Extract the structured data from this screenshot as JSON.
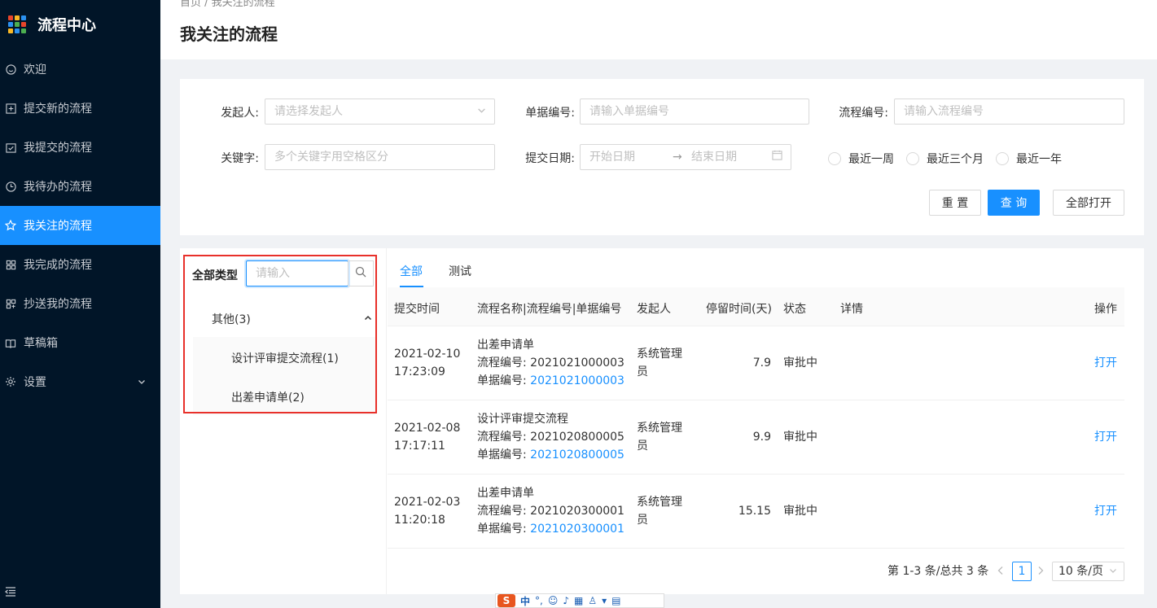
{
  "sidebar": {
    "title": "流程中心",
    "logo_colors": [
      "#e8452b",
      "#f9b825",
      "#2b91f0",
      "#2b91f0",
      "#4caf50",
      "#e8452b",
      "#f9b825",
      "#2b91f0",
      "#4caf50"
    ],
    "items": [
      {
        "label": "欢迎",
        "icon": "smile-icon"
      },
      {
        "label": "提交新的流程",
        "icon": "plus-square-icon"
      },
      {
        "label": "我提交的流程",
        "icon": "check-square-icon"
      },
      {
        "label": "我待办的流程",
        "icon": "clock-icon"
      },
      {
        "label": "我关注的流程",
        "icon": "star-icon",
        "active": true
      },
      {
        "label": "我完成的流程",
        "icon": "appstore-icon"
      },
      {
        "label": "抄送我的流程",
        "icon": "copy-icon"
      },
      {
        "label": "草稿箱",
        "icon": "book-icon"
      },
      {
        "label": "设置",
        "icon": "gear-icon"
      }
    ]
  },
  "header": {
    "breadcrumb": "首页  /  我关注的流程",
    "title": "我关注的流程"
  },
  "filters": {
    "initiator_label": "发起人:",
    "initiator_placeholder": "请选择发起人",
    "doc_no_label": "单据编号:",
    "doc_no_placeholder": "请输入单据编号",
    "flow_no_label": "流程编号:",
    "flow_no_placeholder": "请输入流程编号",
    "keyword_label": "关键字:",
    "keyword_placeholder": "多个关键字用空格区分",
    "date_label": "提交日期:",
    "date_start": "开始日期",
    "date_arrow": "→",
    "date_end": "结束日期",
    "radio_week": "最近一周",
    "radio_3m": "最近三个月",
    "radio_year": "最近一年",
    "reset": "重 置",
    "query": "查 询",
    "open_all": "全部打开"
  },
  "tree": {
    "head": "全部类型",
    "search_placeholder": "请输入",
    "group": "其他(3)",
    "children": [
      "设计评审提交流程(1)",
      "出差申请单(2)"
    ]
  },
  "tabs": [
    "全部",
    "测试"
  ],
  "table": {
    "columns": [
      "提交时间",
      "流程名称|流程编号|单据编号",
      "发起人",
      "停留时间(天)",
      "状态",
      "详情",
      "操作"
    ],
    "rows": [
      {
        "date": "2021-02-10",
        "time": "17:23:09",
        "name": "出差申请单",
        "flow_no": "流程编号: 2021021000003",
        "doc_prefix": "单据编号: ",
        "doc_no": "2021021000003",
        "initiator_1": "系统管理",
        "initiator_2": "员",
        "days": "7.9",
        "status": "审批中",
        "action": "打开"
      },
      {
        "date": "2021-02-08",
        "time": "17:17:11",
        "name": "设计评审提交流程",
        "flow_no": "流程编号: 2021020800005",
        "doc_prefix": "单据编号: ",
        "doc_no": "2021020800005",
        "initiator_1": "系统管理",
        "initiator_2": "员",
        "days": "9.9",
        "status": "审批中",
        "action": "打开"
      },
      {
        "date": "2021-02-03",
        "time": "11:20:18",
        "name": "出差申请单",
        "flow_no": "流程编号: 2021020300001",
        "doc_prefix": "单据编号: ",
        "doc_no": "2021020300001",
        "initiator_1": "系统管理",
        "initiator_2": "员",
        "days": "15.15",
        "status": "审批中",
        "action": "打开"
      }
    ]
  },
  "pager": {
    "summary": "第 1-3 条/总共 3 条",
    "current": "1",
    "page_size": "10 条/页"
  },
  "ime": {
    "label": "中"
  }
}
